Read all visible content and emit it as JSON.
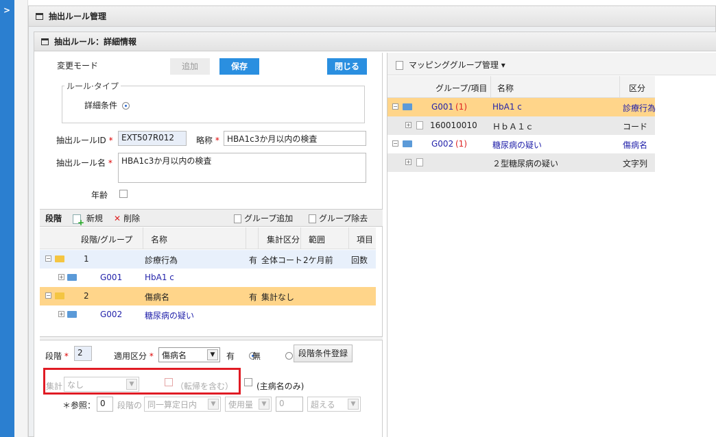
{
  "outer_panel": {
    "title": "抽出ルール管理"
  },
  "inner_panel": {
    "title": "抽出ルール：詳細情報"
  },
  "form": {
    "mode_label": "変更モード",
    "add_button": "追加",
    "save_button": "保存",
    "close_button": "閉じる",
    "rule_type_legend": "ルール·タイプ",
    "rule_type_option": "詳細条件",
    "rule_id_label": "抽出ルールID",
    "rule_id_value": "EXT507R012",
    "short_name_label": "略称",
    "short_name_value": "HBA1c3か月以内の検査",
    "rule_name_label": "抽出ルール名",
    "rule_name_value": "HBA1c3か月以内の検査",
    "age_label": "年齢"
  },
  "stage_toolbar": {
    "title": "段階",
    "new": "新規",
    "delete": "削除",
    "group_add": "グループ追加",
    "group_remove": "グループ除去"
  },
  "stage_grid": {
    "headers": [
      "段階/グループ",
      "名称",
      "集計区分",
      "範囲",
      "項目"
    ],
    "rows": [
      {
        "stage": "1",
        "name": "診療行為",
        "flag": "有",
        "agg": "全体コート",
        "range": "2ケ月前",
        "item": "回数"
      },
      {
        "stage": "G001",
        "name": "HbA1 c"
      },
      {
        "stage": "2",
        "name": "傷病名",
        "flag": "有",
        "agg": "集計なし",
        "range": "",
        "item": ""
      },
      {
        "stage": "G002",
        "name": "糖尿病の疑い"
      }
    ]
  },
  "stage_form": {
    "stage_label": "段階",
    "stage_value": "2",
    "apply_label": "適用区分",
    "apply_value": "傷病名",
    "yes_label": "有",
    "no_label": "無",
    "register_button": "段階条件登録",
    "agg_label": "集計",
    "agg_value": "なし",
    "include_transfer": "（転帰を含む）",
    "main_disease_only": "(主病名のみ)",
    "ref_label": "＊参照：",
    "ref_value": "0",
    "stage_of": "段階の",
    "period_value": "同一算定日内",
    "usage_value": "使用量",
    "qty_value": "0",
    "exceed_value": "超える"
  },
  "mapping": {
    "title": "マッピンググループ管理",
    "headers": [
      "グループ/項目",
      "名称",
      "区分"
    ],
    "rows": [
      {
        "code": "G001",
        "count": "(1)",
        "name": "HbA1 c",
        "category": "診療行為"
      },
      {
        "code": "160010010",
        "name": "ＨｂＡ１ｃ",
        "category": "コード"
      },
      {
        "code": "G002",
        "count": "(1)",
        "name": "糖尿病の疑い",
        "category": "傷病名"
      },
      {
        "code": "",
        "name": "２型糖尿病の疑い",
        "category": "文字列"
      }
    ]
  }
}
